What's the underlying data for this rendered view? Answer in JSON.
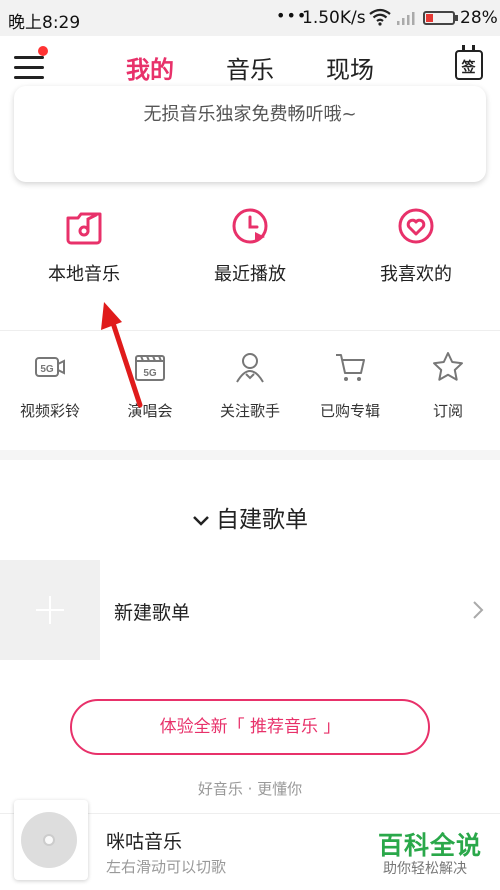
{
  "status_bar": {
    "time": "晚上8:29",
    "dots": "•••",
    "speed": "1.50K/s",
    "battery": "28%",
    "battery_level": 0.28
  },
  "nav": {
    "tabs": [
      {
        "label": "我的"
      },
      {
        "label": "音乐"
      },
      {
        "label": "现场"
      }
    ],
    "active_tab": "我的",
    "calendar_label": "签"
  },
  "banner": {
    "text": "无损音乐独家免费畅听哦~"
  },
  "quick_entries": [
    {
      "label": "本地音乐",
      "icon": "local-music-icon"
    },
    {
      "label": "最近播放",
      "icon": "recent-play-icon"
    },
    {
      "label": "我喜欢的",
      "icon": "favorite-icon"
    }
  ],
  "features": [
    {
      "label": "视频彩铃",
      "icon": "video-ringtone-icon",
      "badge": "5G"
    },
    {
      "label": "演唱会",
      "icon": "concert-icon",
      "badge": "5G"
    },
    {
      "label": "关注歌手",
      "icon": "follow-singer-icon"
    },
    {
      "label": "已购专辑",
      "icon": "cart-icon"
    },
    {
      "label": "订阅",
      "icon": "star-icon"
    }
  ],
  "playlists": {
    "title": "自建歌单",
    "new_label": "新建歌单",
    "recommend_button": "体验全新「 推荐音乐 」",
    "slogan": "好音乐 · 更懂你"
  },
  "player": {
    "title": "咪咕音乐",
    "subtitle": "左右滑动可以切歌"
  },
  "watermark": {
    "title": "百科全说",
    "subtitle": "助你轻松解决"
  },
  "colors": {
    "accent": "#e8316a",
    "watermark": "#2aa84a"
  }
}
